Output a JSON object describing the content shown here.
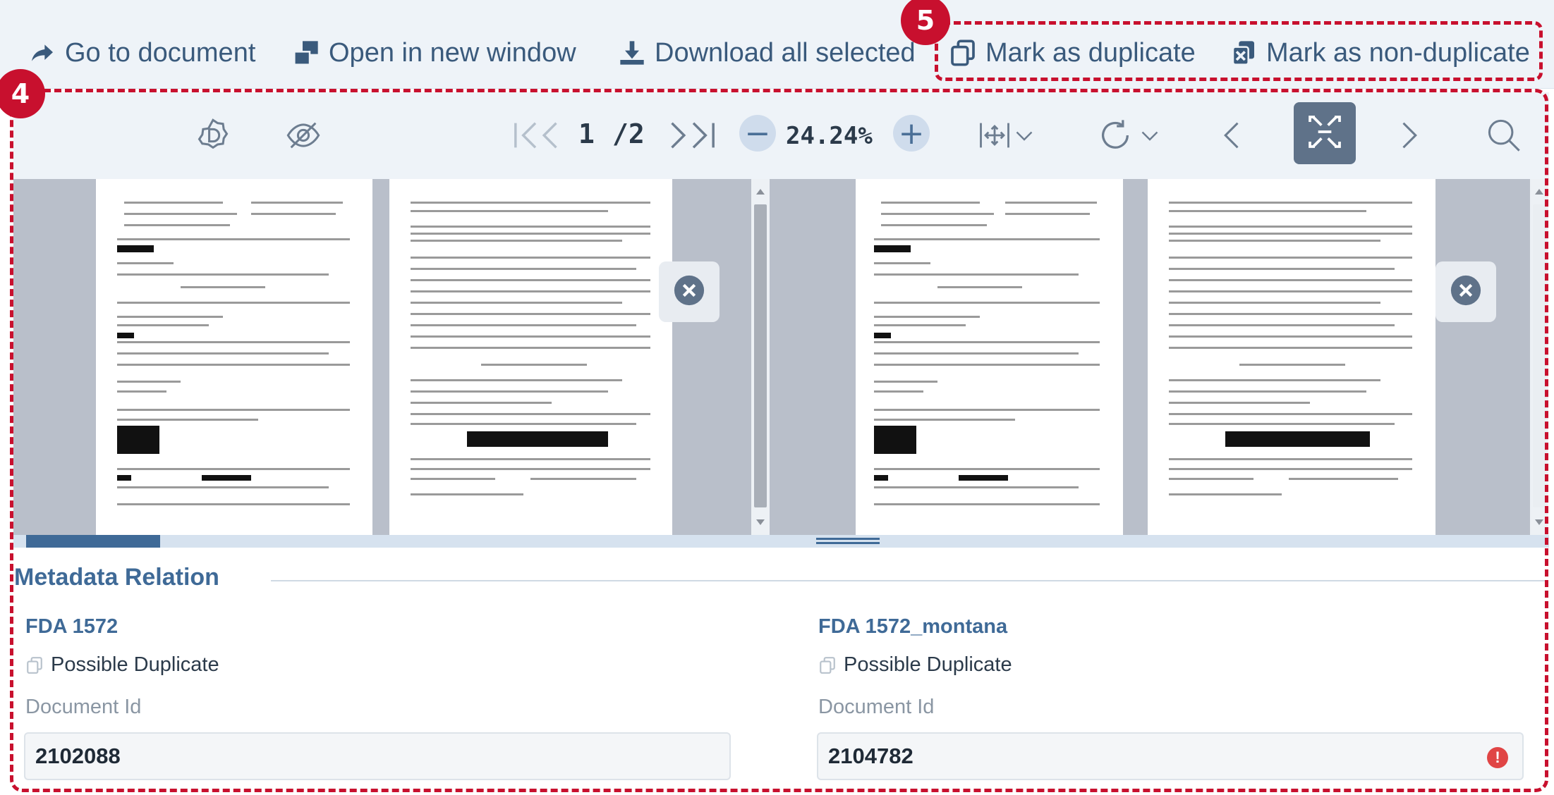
{
  "actions": {
    "go_to_document": "Go to document",
    "open_new_window": "Open in new window",
    "download_all": "Download all selected",
    "mark_duplicate": "Mark as duplicate",
    "mark_non_duplicate": "Mark as non-duplicate"
  },
  "callouts": {
    "actions_group": "5",
    "viewer_group": "4"
  },
  "viewer": {
    "current_page": "1",
    "total_pages": "/2",
    "zoom": "24.24%"
  },
  "metadata": {
    "section_title": "Metadata Relation",
    "left": {
      "name": "FDA 1572",
      "status": "Possible Duplicate",
      "id_label": "Document Id",
      "id_value": "2102088"
    },
    "right": {
      "name": "FDA 1572_montana",
      "status": "Possible Duplicate",
      "id_label": "Document Id",
      "id_value": "2104782",
      "warning_icon": "exclamation-circle-icon"
    }
  },
  "colors": {
    "accent": "#3f6a97",
    "callout": "#c8102e",
    "warning": "#e04545"
  }
}
